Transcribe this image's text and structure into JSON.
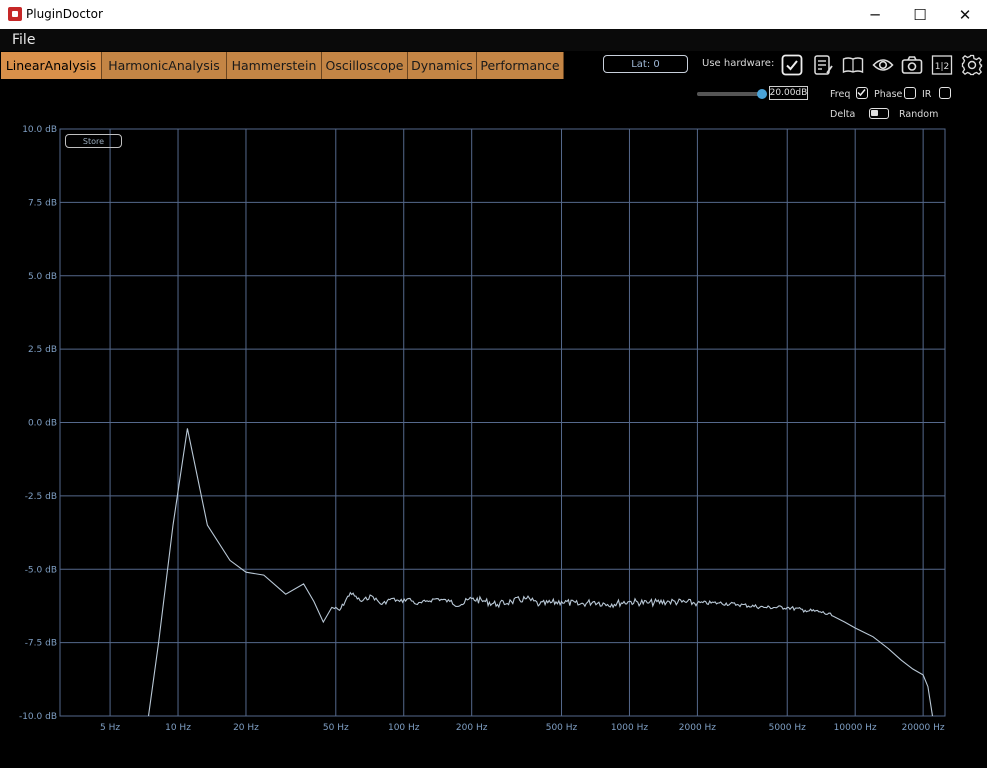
{
  "window": {
    "title": "PluginDoctor",
    "minimize_glyph": "─",
    "maximize_glyph": "☐",
    "close_glyph": "✕"
  },
  "menu": {
    "file": "File"
  },
  "tabs": [
    {
      "label": "LinearAnalysis",
      "active": true
    },
    {
      "label": "HarmonicAnalysis",
      "active": false
    },
    {
      "label": "Hammerstein",
      "active": false
    },
    {
      "label": "Oscilloscope",
      "active": false
    },
    {
      "label": "Dynamics",
      "active": false
    },
    {
      "label": "Performance",
      "active": false
    }
  ],
  "toolbar": {
    "latency": "Lat: 0",
    "use_hardware_label": "Use hardware:",
    "use_hardware_checked": true,
    "icons": [
      "checkbox-icon",
      "notes-icon",
      "book-icon",
      "eye-icon",
      "camera-icon",
      "compare-icon",
      "gear-icon"
    ],
    "compare_text": "1|2"
  },
  "controls": {
    "range_value": "20.00dB",
    "range_fraction": 0.95,
    "freq_label": "Freq",
    "freq_checked": true,
    "phase_label": "Phase",
    "phase_checked": false,
    "ir_label": "IR",
    "ir_checked": false,
    "delta_label": "Delta",
    "random_label": "Random"
  },
  "store_label": "Store",
  "colors": {
    "tab": "#c48545",
    "tab_active": "#d9904a",
    "grid": "#55698c",
    "trace": "#b9c8d6",
    "axis_label": "#7f9fc4"
  },
  "chart_data": {
    "type": "line",
    "x_scale": "log",
    "xlim": [
      3,
      25000
    ],
    "ylim": [
      -10,
      10
    ],
    "y_ticks": [
      10,
      7.5,
      5,
      2.5,
      0,
      -2.5,
      -5,
      -7.5,
      -10
    ],
    "y_tick_labels": [
      "10.0 dB",
      "7.5 dB",
      "5.0 dB",
      "2.5 dB",
      "0.0 dB",
      "-2.5 dB",
      "-5.0 dB",
      "-7.5 dB",
      "-10.0 dB"
    ],
    "x_ticks": [
      5,
      10,
      20,
      50,
      100,
      200,
      500,
      1000,
      2000,
      5000,
      10000,
      20000
    ],
    "x_tick_labels": [
      "5 Hz",
      "10 Hz",
      "20 Hz",
      "50 Hz",
      "100 Hz",
      "200 Hz",
      "500 Hz",
      "1000 Hz",
      "2000 Hz",
      "5000 Hz",
      "10000 Hz",
      "20000 Hz"
    ],
    "grid": true,
    "series": [
      {
        "x": [
          7.4,
          8.2,
          9.5,
          11,
          13.5,
          17,
          20,
          24,
          30,
          36,
          40,
          44,
          48,
          52,
          58,
          65,
          72,
          80,
          88,
          96,
          105,
          115,
          125,
          140,
          160,
          180,
          200,
          230,
          260,
          300,
          350,
          400,
          500,
          600,
          700,
          800,
          1000,
          1200,
          1500,
          2000,
          2500,
          3000,
          4000,
          5000,
          6000,
          7000,
          8000,
          9000,
          10000,
          12000,
          14000,
          16000,
          18000,
          20000,
          21000,
          22000
        ],
        "y": [
          -10,
          -7.5,
          -3.5,
          -0.2,
          -3.5,
          -4.7,
          -5.1,
          -5.2,
          -5.85,
          -5.5,
          -6.1,
          -6.8,
          -6.3,
          -6.4,
          -5.8,
          -6.1,
          -5.9,
          -6.2,
          -6.0,
          -6.1,
          -6.0,
          -6.2,
          -6.1,
          -6.0,
          -6.1,
          -6.2,
          -6.0,
          -6.1,
          -6.2,
          -6.1,
          -6.0,
          -6.2,
          -6.1,
          -6.2,
          -6.1,
          -6.2,
          -6.1,
          -6.15,
          -6.1,
          -6.15,
          -6.15,
          -6.2,
          -6.3,
          -6.3,
          -6.4,
          -6.45,
          -6.6,
          -6.8,
          -7.0,
          -7.3,
          -7.7,
          -8.1,
          -8.4,
          -8.6,
          -9.0,
          -10
        ]
      }
    ]
  }
}
